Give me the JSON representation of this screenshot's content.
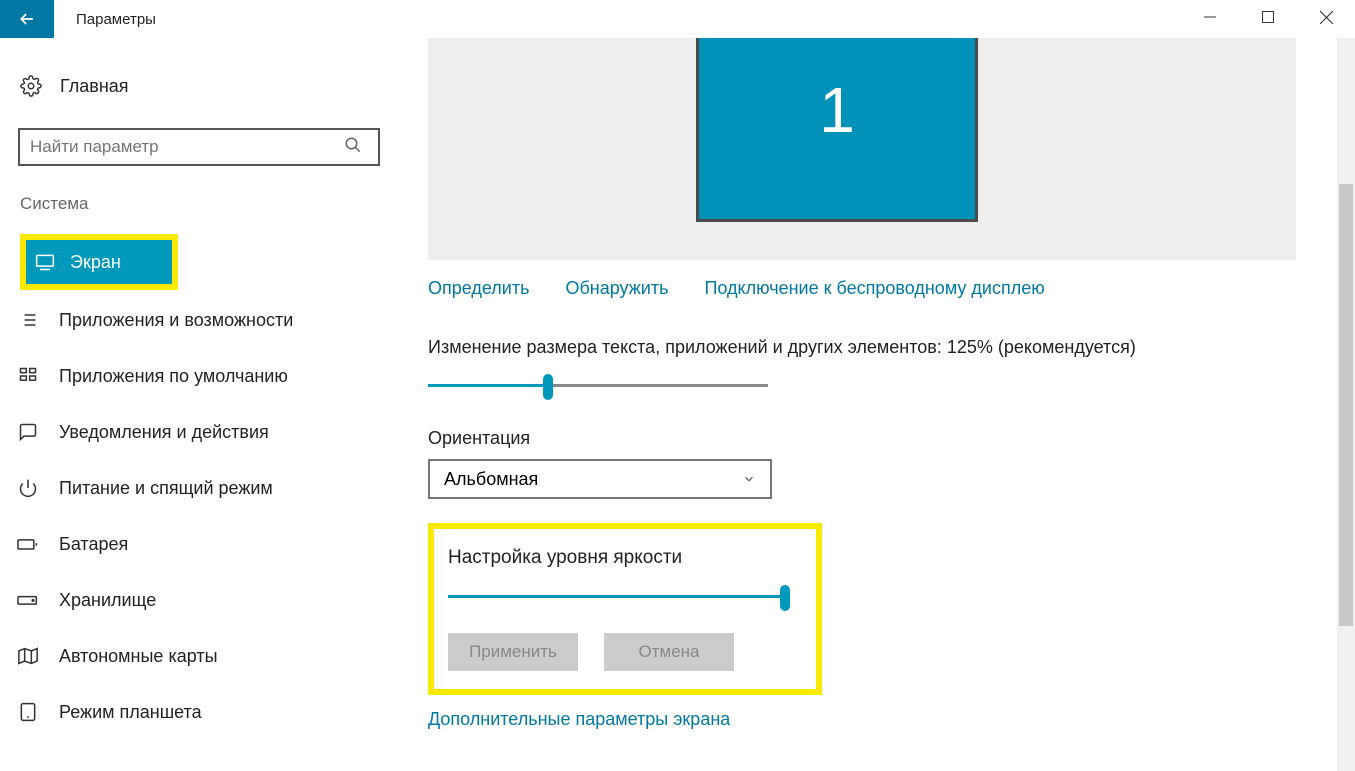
{
  "window": {
    "title": "Параметры"
  },
  "sidebar": {
    "home": "Главная",
    "search_placeholder": "Найти параметр",
    "section": "Система",
    "items": [
      {
        "label": "Экран"
      },
      {
        "label": "Приложения и возможности"
      },
      {
        "label": "Приложения по умолчанию"
      },
      {
        "label": "Уведомления и действия"
      },
      {
        "label": "Питание и спящий режим"
      },
      {
        "label": "Батарея"
      },
      {
        "label": "Хранилище"
      },
      {
        "label": "Автономные карты"
      },
      {
        "label": "Режим планшета"
      }
    ]
  },
  "main": {
    "display_number": "1",
    "links": {
      "identify": "Определить",
      "detect": "Обнаружить",
      "wireless": "Подключение к беспроводному дисплею"
    },
    "scale_label": "Изменение размера текста, приложений и других элементов: 125% (рекомендуется)",
    "orientation_label": "Ориентация",
    "orientation_value": "Альбомная",
    "brightness_label": "Настройка уровня яркости",
    "apply": "Применить",
    "cancel": "Отмена",
    "advanced_link": "Дополнительные параметры экрана"
  }
}
